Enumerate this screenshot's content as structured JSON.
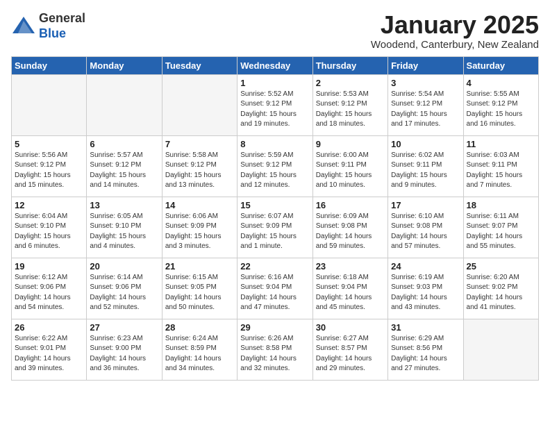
{
  "header": {
    "logo_general": "General",
    "logo_blue": "Blue",
    "month_title": "January 2025",
    "subtitle": "Woodend, Canterbury, New Zealand"
  },
  "calendar": {
    "days_of_week": [
      "Sunday",
      "Monday",
      "Tuesday",
      "Wednesday",
      "Thursday",
      "Friday",
      "Saturday"
    ],
    "weeks": [
      [
        {
          "day": "",
          "info": ""
        },
        {
          "day": "",
          "info": ""
        },
        {
          "day": "",
          "info": ""
        },
        {
          "day": "1",
          "info": "Sunrise: 5:52 AM\nSunset: 9:12 PM\nDaylight: 15 hours\nand 19 minutes."
        },
        {
          "day": "2",
          "info": "Sunrise: 5:53 AM\nSunset: 9:12 PM\nDaylight: 15 hours\nand 18 minutes."
        },
        {
          "day": "3",
          "info": "Sunrise: 5:54 AM\nSunset: 9:12 PM\nDaylight: 15 hours\nand 17 minutes."
        },
        {
          "day": "4",
          "info": "Sunrise: 5:55 AM\nSunset: 9:12 PM\nDaylight: 15 hours\nand 16 minutes."
        }
      ],
      [
        {
          "day": "5",
          "info": "Sunrise: 5:56 AM\nSunset: 9:12 PM\nDaylight: 15 hours\nand 15 minutes."
        },
        {
          "day": "6",
          "info": "Sunrise: 5:57 AM\nSunset: 9:12 PM\nDaylight: 15 hours\nand 14 minutes."
        },
        {
          "day": "7",
          "info": "Sunrise: 5:58 AM\nSunset: 9:12 PM\nDaylight: 15 hours\nand 13 minutes."
        },
        {
          "day": "8",
          "info": "Sunrise: 5:59 AM\nSunset: 9:12 PM\nDaylight: 15 hours\nand 12 minutes."
        },
        {
          "day": "9",
          "info": "Sunrise: 6:00 AM\nSunset: 9:11 PM\nDaylight: 15 hours\nand 10 minutes."
        },
        {
          "day": "10",
          "info": "Sunrise: 6:02 AM\nSunset: 9:11 PM\nDaylight: 15 hours\nand 9 minutes."
        },
        {
          "day": "11",
          "info": "Sunrise: 6:03 AM\nSunset: 9:11 PM\nDaylight: 15 hours\nand 7 minutes."
        }
      ],
      [
        {
          "day": "12",
          "info": "Sunrise: 6:04 AM\nSunset: 9:10 PM\nDaylight: 15 hours\nand 6 minutes."
        },
        {
          "day": "13",
          "info": "Sunrise: 6:05 AM\nSunset: 9:10 PM\nDaylight: 15 hours\nand 4 minutes."
        },
        {
          "day": "14",
          "info": "Sunrise: 6:06 AM\nSunset: 9:09 PM\nDaylight: 15 hours\nand 3 minutes."
        },
        {
          "day": "15",
          "info": "Sunrise: 6:07 AM\nSunset: 9:09 PM\nDaylight: 15 hours\nand 1 minute."
        },
        {
          "day": "16",
          "info": "Sunrise: 6:09 AM\nSunset: 9:08 PM\nDaylight: 14 hours\nand 59 minutes."
        },
        {
          "day": "17",
          "info": "Sunrise: 6:10 AM\nSunset: 9:08 PM\nDaylight: 14 hours\nand 57 minutes."
        },
        {
          "day": "18",
          "info": "Sunrise: 6:11 AM\nSunset: 9:07 PM\nDaylight: 14 hours\nand 55 minutes."
        }
      ],
      [
        {
          "day": "19",
          "info": "Sunrise: 6:12 AM\nSunset: 9:06 PM\nDaylight: 14 hours\nand 54 minutes."
        },
        {
          "day": "20",
          "info": "Sunrise: 6:14 AM\nSunset: 9:06 PM\nDaylight: 14 hours\nand 52 minutes."
        },
        {
          "day": "21",
          "info": "Sunrise: 6:15 AM\nSunset: 9:05 PM\nDaylight: 14 hours\nand 50 minutes."
        },
        {
          "day": "22",
          "info": "Sunrise: 6:16 AM\nSunset: 9:04 PM\nDaylight: 14 hours\nand 47 minutes."
        },
        {
          "day": "23",
          "info": "Sunrise: 6:18 AM\nSunset: 9:04 PM\nDaylight: 14 hours\nand 45 minutes."
        },
        {
          "day": "24",
          "info": "Sunrise: 6:19 AM\nSunset: 9:03 PM\nDaylight: 14 hours\nand 43 minutes."
        },
        {
          "day": "25",
          "info": "Sunrise: 6:20 AM\nSunset: 9:02 PM\nDaylight: 14 hours\nand 41 minutes."
        }
      ],
      [
        {
          "day": "26",
          "info": "Sunrise: 6:22 AM\nSunset: 9:01 PM\nDaylight: 14 hours\nand 39 minutes."
        },
        {
          "day": "27",
          "info": "Sunrise: 6:23 AM\nSunset: 9:00 PM\nDaylight: 14 hours\nand 36 minutes."
        },
        {
          "day": "28",
          "info": "Sunrise: 6:24 AM\nSunset: 8:59 PM\nDaylight: 14 hours\nand 34 minutes."
        },
        {
          "day": "29",
          "info": "Sunrise: 6:26 AM\nSunset: 8:58 PM\nDaylight: 14 hours\nand 32 minutes."
        },
        {
          "day": "30",
          "info": "Sunrise: 6:27 AM\nSunset: 8:57 PM\nDaylight: 14 hours\nand 29 minutes."
        },
        {
          "day": "31",
          "info": "Sunrise: 6:29 AM\nSunset: 8:56 PM\nDaylight: 14 hours\nand 27 minutes."
        },
        {
          "day": "",
          "info": ""
        }
      ]
    ]
  }
}
